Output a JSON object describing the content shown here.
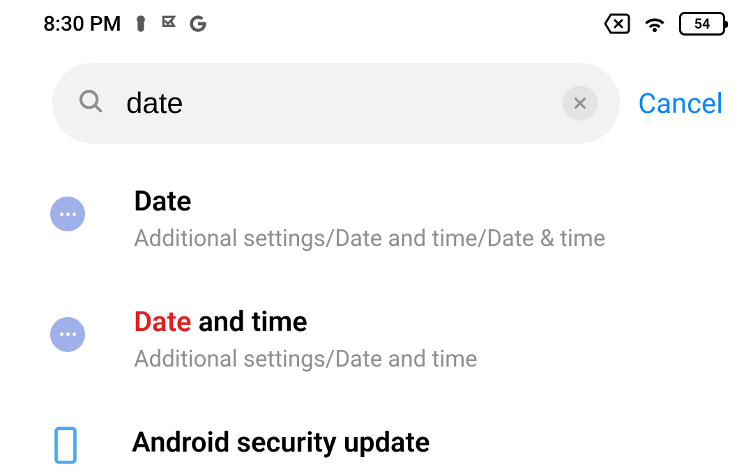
{
  "statusbar": {
    "time": "8:30 PM",
    "battery": "54"
  },
  "search": {
    "value": "date",
    "cancel_label": "Cancel"
  },
  "results": [
    {
      "title_plain": "Date",
      "title_highlight": "",
      "title_suffix": "",
      "path": "Additional settings/Date and time/Date & time",
      "icon": "dots"
    },
    {
      "title_plain": "",
      "title_highlight": "Date",
      "title_suffix": " and time",
      "path": "Additional settings/Date and time",
      "icon": "dots"
    },
    {
      "title_plain": "Android security update",
      "title_highlight": "",
      "title_suffix": "",
      "path": "",
      "icon": "phone"
    }
  ]
}
